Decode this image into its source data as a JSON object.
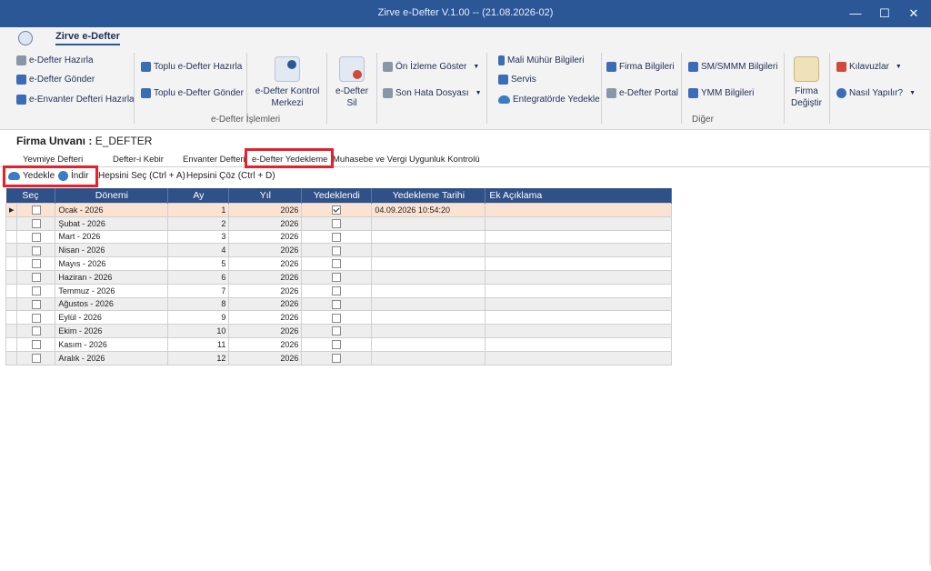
{
  "window": {
    "title": "Zirve e-Defter V.1.00  -- (21.08.2026-02)",
    "minimize": "—",
    "maximize": "☐",
    "close": "✕"
  },
  "ribbon": {
    "tab": "Zirve e-Defter",
    "items": {
      "hazirla": "e-Defter Hazırla",
      "gonder": "e-Defter Gönder",
      "envanter": "e-Envanter Defteri Hazırla",
      "toplu_hazirla": "Toplu e-Defter Hazırla",
      "toplu_gonder": "Toplu e-Defter Gönder",
      "kontrol": "e-Defter Kontrol\nMerkezi",
      "sil": "e-Defter\nSil",
      "onizleme": "Ön İzleme Göster",
      "hata": "Son Hata Dosyası",
      "muhur": "Mali Mühür Bilgileri",
      "servis": "Servis",
      "entegrator": "Entegratörde Yedekle",
      "firma_bilgileri": "Firma Bilgileri",
      "portal": "e-Defter Portal",
      "smmm": "SM/SMMM Bilgileri",
      "ymm": "YMM Bilgileri",
      "firma_degistir": "Firma\nDeğiştir",
      "kilavuzlar": "Kılavuzlar",
      "nasil": "Nasıl Yapılır?"
    },
    "groups": {
      "islemler": "e-Defter İşlemleri",
      "diger": "Diğer"
    }
  },
  "firm": {
    "label": "Firma Unvanı :",
    "value": "E_DEFTER"
  },
  "tabs": [
    "Yevmiye Defteri",
    "Defter-i Kebir",
    "Envanter Defteri",
    "e-Defter Yedekleme",
    "Muhasebe ve Vergi Uygunluk Kontrolü"
  ],
  "toolbar": {
    "yedekle": "Yedekle",
    "indir": "İndir",
    "sec_all": "Hepsini Seç (Ctrl + A)",
    "coz_all": "Hepsini Çöz (Ctrl + D)"
  },
  "table": {
    "headers": [
      "Seç",
      "Dönemi",
      "Ay",
      "Yıl",
      "Yedeklendi",
      "Yedekleme Tarihi",
      "Ek Açıklama"
    ],
    "rows": [
      {
        "donem": "Ocak - 2026",
        "ay": "1",
        "yil": "2026",
        "yedeklendi": true,
        "tarih": "04.09.2026 10:54:20",
        "aciklama": ""
      },
      {
        "donem": "Şubat - 2026",
        "ay": "2",
        "yil": "2026",
        "yedeklendi": false,
        "tarih": "",
        "aciklama": ""
      },
      {
        "donem": "Mart - 2026",
        "ay": "3",
        "yil": "2026",
        "yedeklendi": false,
        "tarih": "",
        "aciklama": ""
      },
      {
        "donem": "Nisan - 2026",
        "ay": "4",
        "yil": "2026",
        "yedeklendi": false,
        "tarih": "",
        "aciklama": ""
      },
      {
        "donem": "Mayıs - 2026",
        "ay": "5",
        "yil": "2026",
        "yedeklendi": false,
        "tarih": "",
        "aciklama": ""
      },
      {
        "donem": "Haziran - 2026",
        "ay": "6",
        "yil": "2026",
        "yedeklendi": false,
        "tarih": "",
        "aciklama": ""
      },
      {
        "donem": "Temmuz - 2026",
        "ay": "7",
        "yil": "2026",
        "yedeklendi": false,
        "tarih": "",
        "aciklama": ""
      },
      {
        "donem": "Ağustos - 2026",
        "ay": "8",
        "yil": "2026",
        "yedeklendi": false,
        "tarih": "",
        "aciklama": ""
      },
      {
        "donem": "Eylül - 2026",
        "ay": "9",
        "yil": "2026",
        "yedeklendi": false,
        "tarih": "",
        "aciklama": ""
      },
      {
        "donem": "Ekim - 2026",
        "ay": "10",
        "yil": "2026",
        "yedeklendi": false,
        "tarih": "",
        "aciklama": ""
      },
      {
        "donem": "Kasım - 2026",
        "ay": "11",
        "yil": "2026",
        "yedeklendi": false,
        "tarih": "",
        "aciklama": ""
      },
      {
        "donem": "Aralık - 2026",
        "ay": "12",
        "yil": "2026",
        "yedeklendi": false,
        "tarih": "",
        "aciklama": ""
      }
    ]
  },
  "colors": {
    "titlebar": "#2b5797",
    "header": "#2f5188",
    "selected_row": "#fbe3d3",
    "highlight": "#e8202a"
  }
}
